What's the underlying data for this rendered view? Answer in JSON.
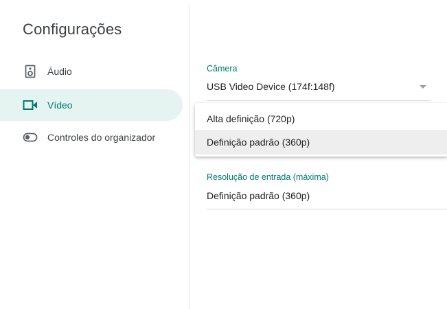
{
  "sidebar": {
    "title": "Configurações",
    "items": [
      {
        "label": "Áudio",
        "icon": "speaker-icon",
        "active": false
      },
      {
        "label": "Vídeo",
        "icon": "videocam-icon",
        "active": true
      },
      {
        "label": "Controles do organizador",
        "icon": "toggle-icon",
        "active": false
      }
    ]
  },
  "camera": {
    "label": "Câmera",
    "value": "USB Video Device (174f:148f)"
  },
  "resolution_menu": {
    "options": [
      "Alta definição (720p)",
      "Definição padrão (360p)"
    ],
    "selected": "Definição padrão (360p)"
  },
  "input_resolution": {
    "label": "Resolução de entrada (máxima)",
    "value": "Definição padrão (360p)"
  },
  "colors": {
    "accent": "#00796b",
    "active_bg": "#e6f4f1",
    "text": "#3c4043",
    "divider": "#dadce0"
  }
}
